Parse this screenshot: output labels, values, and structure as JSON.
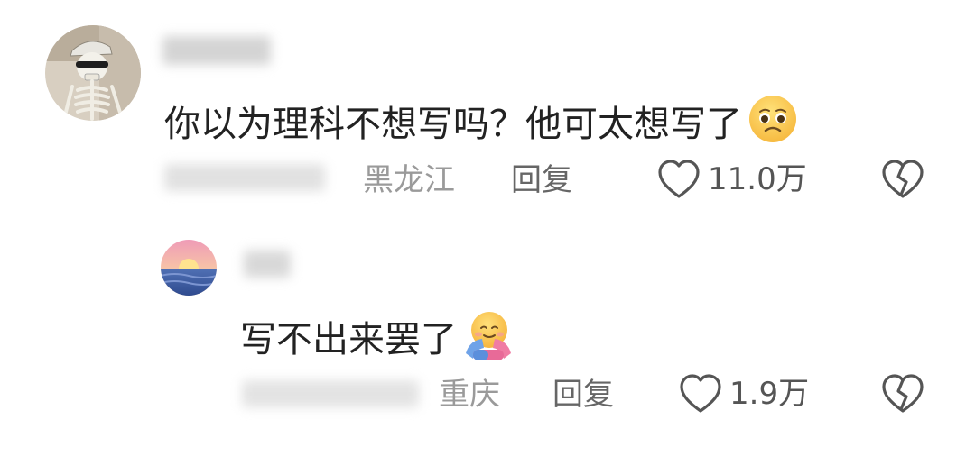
{
  "comments": [
    {
      "avatar_icon": "skeleton-avatar-icon",
      "text": "你以为理科不想写吗？他可太想写了",
      "emoji": "pleading-face-emoji",
      "location": "黑龙江",
      "reply_label": "回复",
      "likes": "11.0万"
    },
    {
      "avatar_icon": "sunset-sea-avatar-icon",
      "text": "写不出来罢了",
      "emoji": "hugging-face-emoji",
      "location": "重庆",
      "reply_label": "回复",
      "likes": "1.9万"
    }
  ],
  "icons": {
    "like": "heart-outline-icon",
    "dislike": "broken-heart-icon"
  },
  "colors": {
    "text": "#222222",
    "meta": "#9a9a9a",
    "icon": "#555555"
  }
}
